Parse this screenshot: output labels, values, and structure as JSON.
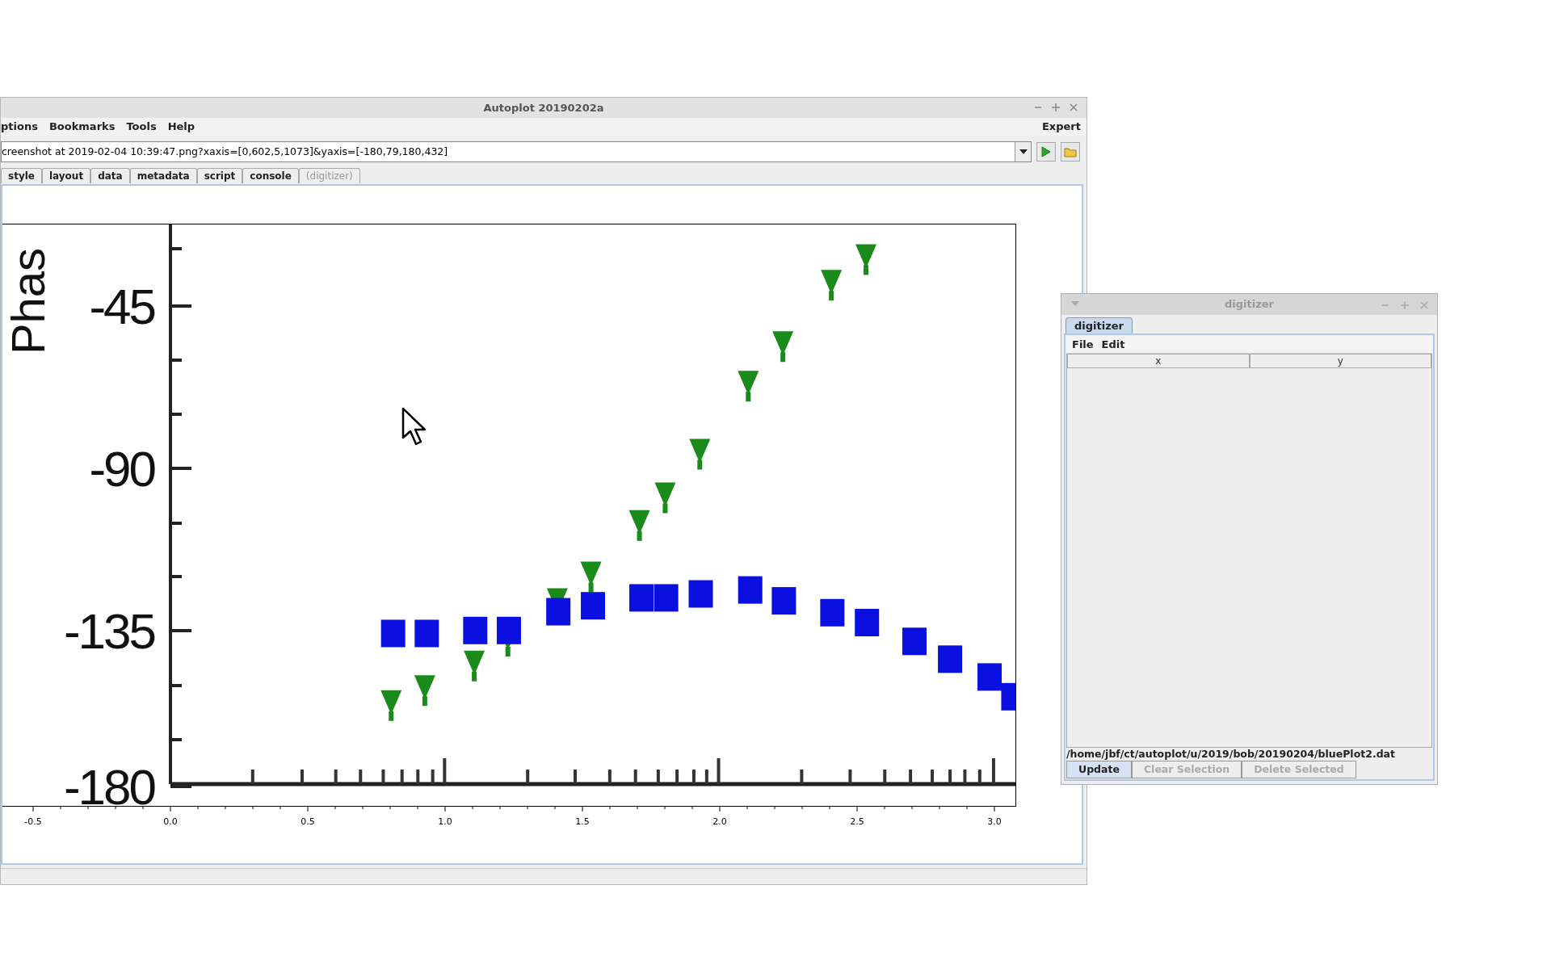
{
  "main_window": {
    "title": "Autoplot 20190202a",
    "menu": [
      "ptions",
      "Bookmarks",
      "Tools",
      "Help"
    ],
    "mode_label": "Expert",
    "address": {
      "value": "creenshot at 2019-02-04 10:39:47.png?xaxis=[0,602,5,1073]&yaxis=[-180,79,180,432]"
    },
    "tabs": [
      {
        "label": "style",
        "selected": false,
        "disabled": false
      },
      {
        "label": "layout",
        "selected": false,
        "disabled": false
      },
      {
        "label": "data",
        "selected": false,
        "disabled": false
      },
      {
        "label": "metadata",
        "selected": false,
        "disabled": false
      },
      {
        "label": "script",
        "selected": false,
        "disabled": false
      },
      {
        "label": "console",
        "selected": false,
        "disabled": false
      },
      {
        "label": "(digitizer)",
        "selected": false,
        "disabled": true
      }
    ],
    "plot_image": {
      "ylabel": "Phas",
      "yticks": [
        "-45",
        "-90",
        "-135",
        "-180"
      ]
    },
    "x_axis": {
      "ticks": [
        "-0.5",
        "0.0",
        "0.5",
        "1.0",
        "1.5",
        "2.0",
        "2.5",
        "3.0"
      ]
    }
  },
  "digitizer_window": {
    "title": "digitizer",
    "tabs": [
      {
        "label": "digitizer",
        "selected": true
      }
    ],
    "menu": [
      "File",
      "Edit"
    ],
    "table": {
      "columns": [
        "x",
        "y"
      ]
    },
    "file_path": "/home/jbf/ct/autoplot/u/2019/bob/20190204/bluePlot2.dat",
    "buttons": [
      {
        "label": "Update",
        "disabled": false
      },
      {
        "label": "Clear Selection",
        "disabled": true
      },
      {
        "label": "Delete Selected",
        "disabled": true
      }
    ]
  }
}
